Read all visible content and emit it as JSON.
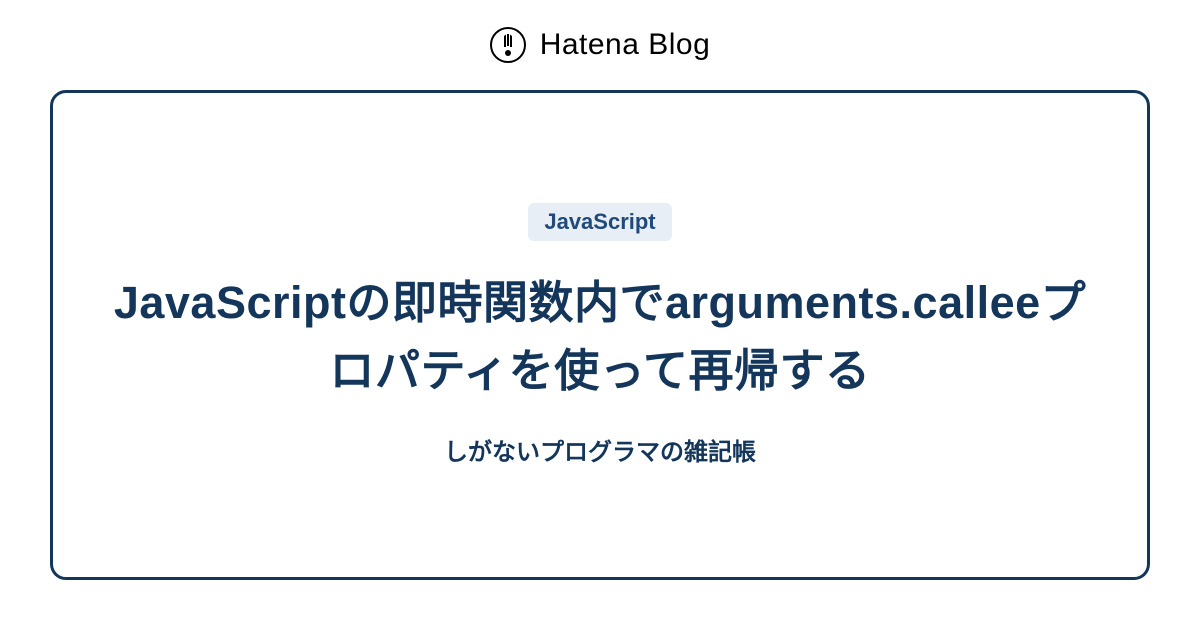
{
  "header": {
    "logo_text": "Hatena Blog"
  },
  "card": {
    "tag": "JavaScript",
    "title": "JavaScriptの即時関数内でarguments.calleeプロパティを使って再帰する",
    "subtitle": "しがないプログラマの雑記帳"
  },
  "colors": {
    "primary": "#14365a",
    "tag_bg": "#e8eef6",
    "tag_text": "#1f4a7a"
  }
}
